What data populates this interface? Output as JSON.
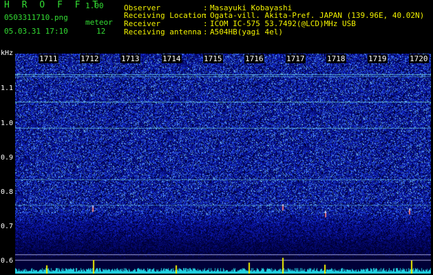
{
  "header": {
    "app_name": "H R O F F T",
    "version": "1.00",
    "filename": "0503311710.png",
    "datetime": "05.03.31 17:10",
    "meteor_label": "meteor",
    "meteor_count": "12"
  },
  "info": [
    {
      "label": "Observer",
      "value": "Masayuki Kobayashi"
    },
    {
      "label": "Receiving Location",
      "value": "Ogata-vill. Akita-Pref. JAPAN (139.96E, 40.02N)"
    },
    {
      "label": "Receiver",
      "value": "ICOM IC-575 53.7492(@LCD)MHz USB"
    },
    {
      "label": "Receiving antenna",
      "value": "A504HB(yagi 4el)"
    }
  ],
  "axis": {
    "unit": "kHz",
    "ticks": [
      "1.1",
      "1.0",
      "0.9",
      "0.8",
      "0.7",
      "0.6"
    ]
  },
  "time_ticks": [
    "1711",
    "1712",
    "1713",
    "1714",
    "1715",
    "1716",
    "1717",
    "1718",
    "1719",
    "1720"
  ],
  "colors": {
    "header_text": "#33dd33",
    "info_text": "#f2f200",
    "background": "#000000"
  }
}
